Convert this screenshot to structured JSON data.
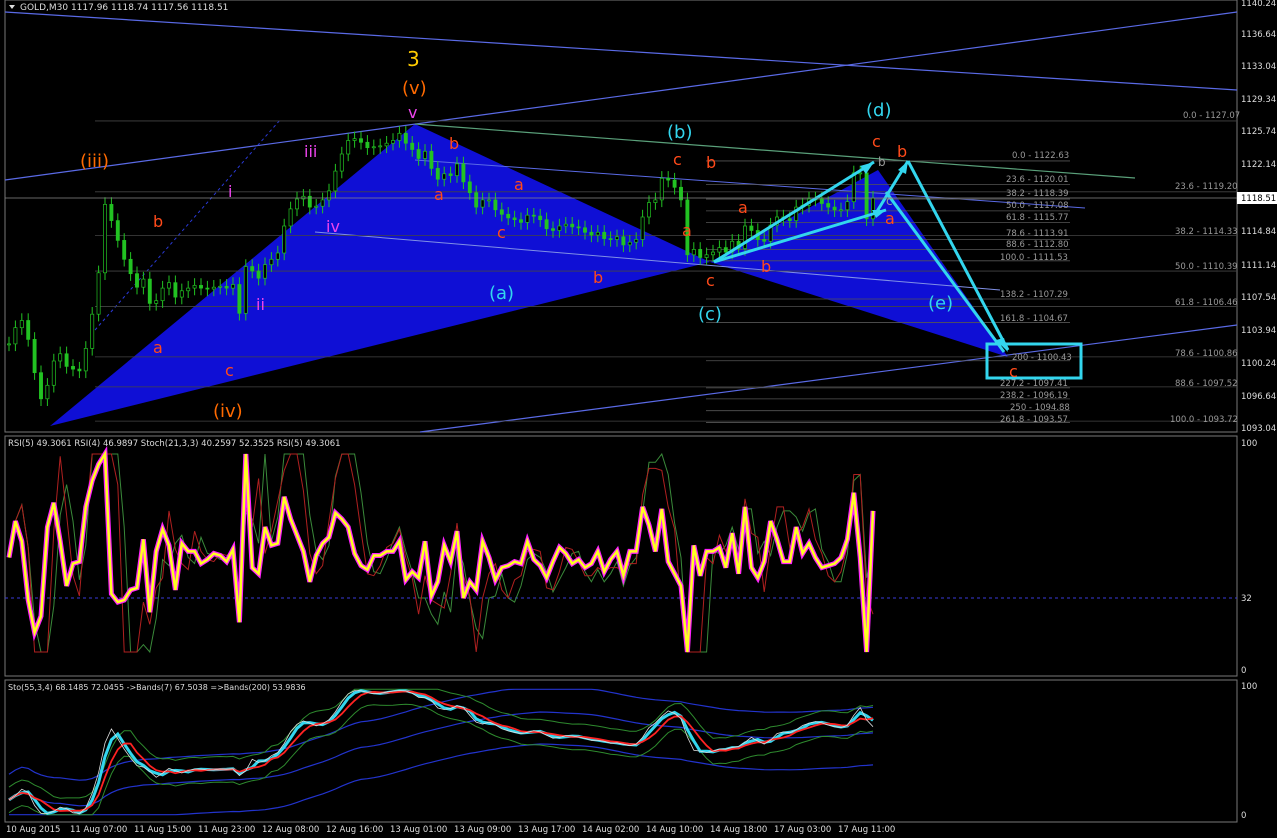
{
  "header": {
    "title": "GOLD,M30  1117.96 1118.74 1117.56 1118.51"
  },
  "price_axis": {
    "ticks": [
      "1140.24",
      "1136.64",
      "1133.04",
      "1129.34",
      "1125.74",
      "1122.14",
      "1114.84",
      "1111.14",
      "1107.54",
      "1103.94",
      "1100.24",
      "1096.64",
      "1093.04"
    ],
    "current_price": "1118.51"
  },
  "time_axis": {
    "labels": [
      "10 Aug 2015",
      "11 Aug 07:00",
      "11 Aug 15:00",
      "11 Aug 23:00",
      "12 Aug 08:00",
      "12 Aug 16:00",
      "13 Aug 01:00",
      "13 Aug 09:00",
      "13 Aug 17:00",
      "14 Aug 02:00",
      "14 Aug 10:00",
      "14 Aug 18:00",
      "17 Aug 03:00",
      "17 Aug 11:00"
    ]
  },
  "fib_levels": {
    "left_set": [
      "0.0 - 1122.63",
      "23.6 - 1120.01",
      "38.2 - 1118.39",
      "50.0 - 1117.08",
      "61.8 - 1115.77",
      "78.6 - 1113.91",
      "88.6 - 1112.80",
      "100.0 - 1111.53",
      "138.2 - 1107.29",
      "161.8 - 1104.67",
      "200 - 1100.43",
      "227.2 - 1097.41",
      "238.2 - 1096.19",
      "250 - 1094.88",
      "261.8 - 1093.57"
    ],
    "right_set": [
      "0.0 - 1127.07",
      "23.6 - 1119.20",
      "38.2 - 1114.33",
      "50.0 - 1110.39",
      "61.8 - 1106.46",
      "78.6 - 1100.86",
      "88.6 - 1097.52",
      "100.0 - 1093.72"
    ]
  },
  "wave_labels": {
    "w3": "3",
    "wv": "(v)",
    "v": "v",
    "wiii": "(iii)",
    "iii": "iii",
    "i": "i",
    "ii": "ii",
    "iv": "iv",
    "wiv": "(iv)",
    "a1": "a",
    "b1": "b",
    "c1": "c",
    "b2": "b",
    "a2": "a",
    "a3": "a",
    "c2": "c",
    "b3": "b",
    "wa": "(a)",
    "wb": "(b)",
    "c3": "c",
    "b4": "b",
    "a4": "a",
    "c4": "c",
    "wc": "(c)",
    "a5": "a",
    "b5": "b",
    "wd": "(d)",
    "c5": "c",
    "b6": "b",
    "b7": "b",
    "c6": "c",
    "a6": "a",
    "we": "(e)",
    "c7": "c"
  },
  "rsi_panel": {
    "title": "RSI(5) 49.3061  RSI(4) 46.9897  Stoch(21,3,3) 40.2597 52.3525  RSI(5) 49.3061",
    "scale_top": "100",
    "scale_mid": "32",
    "scale_bottom": "0"
  },
  "sto_panel": {
    "title": "Sto(55,3,4) 68.1485 72.0455  ->Bands(7) 67.5038  =>Bands(200) 53.9836",
    "scale_top": "100",
    "scale_bottom": "0"
  },
  "colors": {
    "background": "#000000",
    "pattern_fill": "#1010e0",
    "cyan": "#33d6ee",
    "candle": "#22c222",
    "rsi_yellow": "#ffff22",
    "rsi_magenta": "#ff22ff",
    "label_red": "#ff4a1a",
    "label_orange": "#ff6a00",
    "label_magenta": "#ee44ee",
    "label_yellow": "#ffcc00"
  },
  "series": {
    "price_close": [
      1102.3,
      1104.1,
      1104.9,
      1102.8,
      1099.1,
      1096.2,
      1097.7,
      1100.4,
      1101.2,
      1099.8,
      1099.5,
      1099.3,
      1101.8,
      1105.6,
      1110.2,
      1117.8,
      1116.0,
      1113.8,
      1111.7,
      1110.1,
      1108.6,
      1109.5,
      1106.8,
      1107.1,
      1108.5,
      1109.1,
      1107.5,
      1108.2,
      1108.5,
      1108.8,
      1108.5,
      1108.4,
      1108.6,
      1108.7,
      1108.5,
      1108.9,
      1105.7,
      1110.9,
      1110.4,
      1109.6,
      1111.1,
      1111.7,
      1112.4,
      1115.4,
      1117.3,
      1118.4,
      1118.7,
      1117.5,
      1117.6,
      1118.3,
      1119.3,
      1121.5,
      1123.4,
      1124.9,
      1125.1,
      1124.7,
      1124.1,
      1124.2,
      1124.3,
      1124.6,
      1124.9,
      1125.7,
      1124.6,
      1123.9,
      1122.9,
      1123.7,
      1121.8,
      1120.6,
      1121.2,
      1121.0,
      1122.3,
      1120.3,
      1119.1,
      1117.5,
      1118.3,
      1118.3,
      1117.2,
      1116.7,
      1116.3,
      1116.1,
      1115.8,
      1116.6,
      1116.5,
      1116.1,
      1115.1,
      1114.9,
      1115.4,
      1115.6,
      1115.3,
      1115.2,
      1114.7,
      1114.4,
      1114.7,
      1114.0,
      1113.9,
      1114.2,
      1113.3,
      1113.6,
      1113.9,
      1116.4,
      1118.0,
      1118.3,
      1120.7,
      1120.5,
      1119.7,
      1118.3,
      1112.2,
      1112.8,
      1111.9,
      1112.2,
      1112.5,
      1113.0,
      1112.5,
      1113.7,
      1112.9,
      1115.4,
      1114.9,
      1113.9,
      1113.7,
      1115.5,
      1116.4,
      1116.2,
      1116.0,
      1117.5,
      1117.7,
      1118.4,
      1118.4,
      1117.9,
      1117.5,
      1117.2,
      1117.2,
      1118.1,
      1121.3,
      1121.3,
      1116.2,
      1118.5
    ]
  }
}
